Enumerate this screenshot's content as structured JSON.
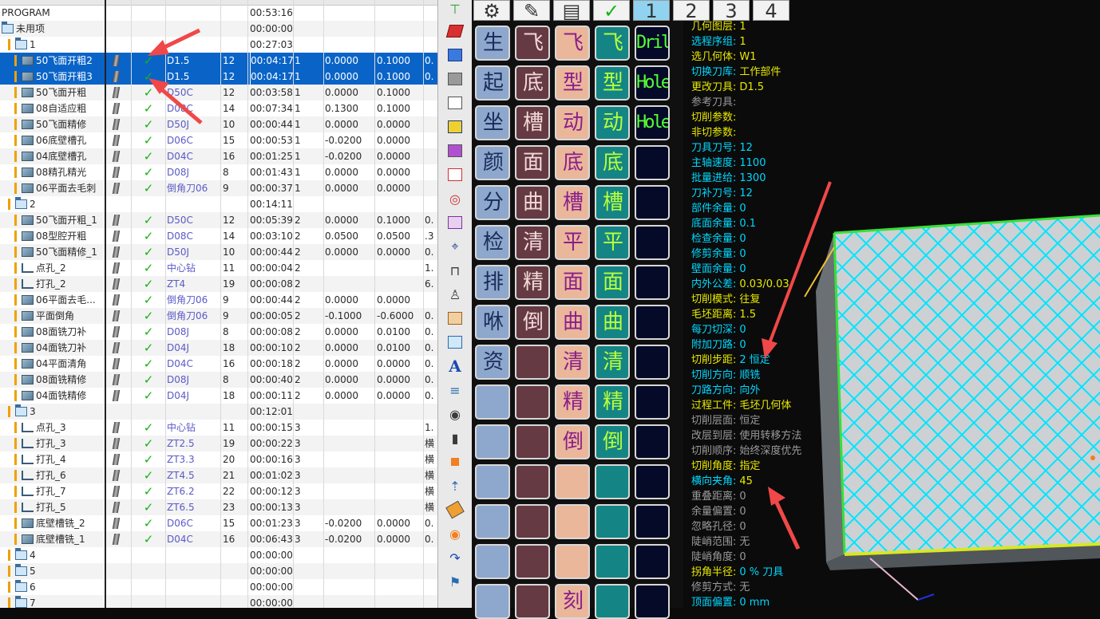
{
  "navigator": {
    "rows": [
      {
        "indent": 0,
        "icon": "none",
        "name": "PROGRAM",
        "gou": false,
        "chk": false,
        "tool": "",
        "num": "",
        "time": "00:53:16",
        "lay": "",
        "a": "",
        "b": "",
        "e": "",
        "sel": false
      },
      {
        "indent": 0,
        "icon": "folder",
        "name": "未用项",
        "gou": false,
        "chk": false,
        "tool": "",
        "num": "",
        "time": "00:00:00",
        "lay": "",
        "a": "",
        "b": "",
        "e": "",
        "sel": false
      },
      {
        "indent": 1,
        "icon": "folder",
        "name": "1",
        "gou": false,
        "chk": false,
        "tool": "",
        "num": "",
        "time": "00:27:03",
        "lay": "",
        "a": "",
        "b": "",
        "e": "",
        "sel": false
      },
      {
        "indent": 2,
        "icon": "op",
        "name": "50飞面开粗2",
        "gou": true,
        "chk": true,
        "tool": "D1.5",
        "num": "12",
        "time": "00:04:17",
        "lay": "1",
        "a": "0.0000",
        "b": "0.1000",
        "e": "0.",
        "sel": true
      },
      {
        "indent": 2,
        "icon": "op",
        "name": "50飞面开粗3",
        "gou": true,
        "chk": true,
        "tool": "D1.5",
        "num": "12",
        "time": "00:04:17",
        "lay": "1",
        "a": "0.0000",
        "b": "0.1000",
        "e": "0.",
        "sel": true
      },
      {
        "indent": 2,
        "icon": "op",
        "name": "50飞面开粗",
        "gou": true,
        "chk": true,
        "tool": "D50C",
        "num": "12",
        "time": "00:03:58",
        "lay": "1",
        "a": "0.0000",
        "b": "0.1000",
        "e": "",
        "sel": false
      },
      {
        "indent": 2,
        "icon": "op",
        "name": "08自适应粗",
        "gou": true,
        "chk": true,
        "tool": "D08C",
        "num": "14",
        "time": "00:07:34",
        "lay": "1",
        "a": "0.1300",
        "b": "0.1000",
        "e": "",
        "sel": false
      },
      {
        "indent": 2,
        "icon": "op",
        "name": "50飞面精修",
        "gou": true,
        "chk": true,
        "tool": "D50J",
        "num": "10",
        "time": "00:00:44",
        "lay": "1",
        "a": "0.0000",
        "b": "0.0000",
        "e": "",
        "sel": false
      },
      {
        "indent": 2,
        "icon": "op",
        "name": "06底壁槽孔",
        "gou": true,
        "chk": true,
        "tool": "D06C",
        "num": "15",
        "time": "00:00:53",
        "lay": "1",
        "a": "-0.0200",
        "b": "0.0000",
        "e": "",
        "sel": false
      },
      {
        "indent": 2,
        "icon": "op",
        "name": "04底壁槽孔",
        "gou": true,
        "chk": true,
        "tool": "D04C",
        "num": "16",
        "time": "00:01:25",
        "lay": "1",
        "a": "-0.0200",
        "b": "0.0000",
        "e": "",
        "sel": false
      },
      {
        "indent": 2,
        "icon": "op",
        "name": "08精孔精光",
        "gou": true,
        "chk": true,
        "tool": "D08J",
        "num": "8",
        "time": "00:01:43",
        "lay": "1",
        "a": "0.0000",
        "b": "0.0000",
        "e": "",
        "sel": false
      },
      {
        "indent": 2,
        "icon": "op",
        "name": "06平面去毛刺",
        "gou": true,
        "chk": true,
        "tool": "倒角刀06",
        "num": "9",
        "time": "00:00:37",
        "lay": "1",
        "a": "0.0000",
        "b": "0.0000",
        "e": "",
        "sel": false
      },
      {
        "indent": 1,
        "icon": "folder",
        "name": "2",
        "gou": false,
        "chk": false,
        "tool": "",
        "num": "",
        "time": "00:14:11",
        "lay": "",
        "a": "",
        "b": "",
        "e": "",
        "sel": false
      },
      {
        "indent": 2,
        "icon": "op",
        "name": "50飞面开粗_1",
        "gou": true,
        "chk": true,
        "tool": "D50C",
        "num": "12",
        "time": "00:05:39",
        "lay": "2",
        "a": "0.0000",
        "b": "0.1000",
        "e": "0.",
        "sel": false
      },
      {
        "indent": 2,
        "icon": "op",
        "name": "08型腔开粗",
        "gou": true,
        "chk": true,
        "tool": "D08C",
        "num": "14",
        "time": "00:03:10",
        "lay": "2",
        "a": "0.0500",
        "b": "0.0500",
        "e": ".3",
        "sel": false
      },
      {
        "indent": 2,
        "icon": "op",
        "name": "50飞面精修_1",
        "gou": true,
        "chk": true,
        "tool": "D50J",
        "num": "10",
        "time": "00:00:44",
        "lay": "2",
        "a": "0.0000",
        "b": "0.0000",
        "e": "0.",
        "sel": false
      },
      {
        "indent": 2,
        "icon": "drill",
        "name": "点孔_2",
        "gou": true,
        "chk": true,
        "tool": "中心钻",
        "num": "11",
        "time": "00:00:04",
        "lay": "2",
        "a": "",
        "b": "",
        "e": "1.",
        "sel": false
      },
      {
        "indent": 2,
        "icon": "drill",
        "name": "打孔_2",
        "gou": true,
        "chk": true,
        "tool": "ZT4",
        "num": "19",
        "time": "00:00:08",
        "lay": "2",
        "a": "",
        "b": "",
        "e": "6.",
        "sel": false
      },
      {
        "indent": 2,
        "icon": "op",
        "name": "06平面去毛...",
        "gou": true,
        "chk": true,
        "tool": "倒角刀06",
        "num": "9",
        "time": "00:00:44",
        "lay": "2",
        "a": "0.0000",
        "b": "0.0000",
        "e": "",
        "sel": false
      },
      {
        "indent": 2,
        "icon": "op",
        "name": "平面倒角",
        "gou": true,
        "chk": true,
        "tool": "倒角刀06",
        "num": "9",
        "time": "00:00:05",
        "lay": "2",
        "a": "-0.1000",
        "b": "-0.6000",
        "e": "0.",
        "sel": false
      },
      {
        "indent": 2,
        "icon": "op",
        "name": "08面铣刀补",
        "gou": true,
        "chk": true,
        "tool": "D08J",
        "num": "8",
        "time": "00:00:08",
        "lay": "2",
        "a": "0.0000",
        "b": "0.0100",
        "e": "0.",
        "sel": false
      },
      {
        "indent": 2,
        "icon": "op",
        "name": "04面铣刀补",
        "gou": true,
        "chk": true,
        "tool": "D04J",
        "num": "18",
        "time": "00:00:10",
        "lay": "2",
        "a": "0.0000",
        "b": "0.0100",
        "e": "0.",
        "sel": false
      },
      {
        "indent": 2,
        "icon": "op",
        "name": "04平面清角",
        "gou": true,
        "chk": true,
        "tool": "D04C",
        "num": "16",
        "time": "00:00:18",
        "lay": "2",
        "a": "0.0000",
        "b": "0.0000",
        "e": "0.",
        "sel": false
      },
      {
        "indent": 2,
        "icon": "op",
        "name": "08面铣精修",
        "gou": true,
        "chk": true,
        "tool": "D08J",
        "num": "8",
        "time": "00:00:40",
        "lay": "2",
        "a": "0.0000",
        "b": "0.0000",
        "e": "0.",
        "sel": false
      },
      {
        "indent": 2,
        "icon": "op",
        "name": "04面铣精修",
        "gou": true,
        "chk": true,
        "tool": "D04J",
        "num": "18",
        "time": "00:00:11",
        "lay": "2",
        "a": "0.0000",
        "b": "0.0000",
        "e": "0.",
        "sel": false
      },
      {
        "indent": 1,
        "icon": "folder",
        "name": "3",
        "gou": false,
        "chk": false,
        "tool": "",
        "num": "",
        "time": "00:12:01",
        "lay": "",
        "a": "",
        "b": "",
        "e": "",
        "sel": false
      },
      {
        "indent": 2,
        "icon": "drill",
        "name": "点孔_3",
        "gou": true,
        "chk": true,
        "tool": "中心钻",
        "num": "11",
        "time": "00:00:15",
        "lay": "3",
        "a": "",
        "b": "",
        "e": "1.",
        "sel": false
      },
      {
        "indent": 2,
        "icon": "drill",
        "name": "打孔_3",
        "gou": true,
        "chk": true,
        "tool": "ZT2.5",
        "num": "19",
        "time": "00:00:22",
        "lay": "3",
        "a": "",
        "b": "",
        "e": "横",
        "sel": false
      },
      {
        "indent": 2,
        "icon": "drill",
        "name": "打孔_4",
        "gou": true,
        "chk": true,
        "tool": "ZT3.3",
        "num": "20",
        "time": "00:00:16",
        "lay": "3",
        "a": "",
        "b": "",
        "e": "横",
        "sel": false
      },
      {
        "indent": 2,
        "icon": "drill",
        "name": "打孔_6",
        "gou": true,
        "chk": true,
        "tool": "ZT4.5",
        "num": "21",
        "time": "00:01:02",
        "lay": "3",
        "a": "",
        "b": "",
        "e": "横",
        "sel": false
      },
      {
        "indent": 2,
        "icon": "drill",
        "name": "打孔_7",
        "gou": true,
        "chk": true,
        "tool": "ZT6.2",
        "num": "22",
        "time": "00:00:12",
        "lay": "3",
        "a": "",
        "b": "",
        "e": "横",
        "sel": false
      },
      {
        "indent": 2,
        "icon": "drill",
        "name": "打孔_5",
        "gou": true,
        "chk": true,
        "tool": "ZT6.5",
        "num": "23",
        "time": "00:00:13",
        "lay": "3",
        "a": "",
        "b": "",
        "e": "横",
        "sel": false
      },
      {
        "indent": 2,
        "icon": "op",
        "name": "底壁槽铣_2",
        "gou": true,
        "chk": true,
        "tool": "D06C",
        "num": "15",
        "time": "00:01:23",
        "lay": "3",
        "a": "-0.0200",
        "b": "0.0000",
        "e": "0.",
        "sel": false
      },
      {
        "indent": 2,
        "icon": "op",
        "name": "底壁槽铣_1",
        "gou": true,
        "chk": true,
        "tool": "D04C",
        "num": "16",
        "time": "00:06:43",
        "lay": "3",
        "a": "-0.0200",
        "b": "0.0000",
        "e": "0.",
        "sel": false
      },
      {
        "indent": 1,
        "icon": "folder",
        "name": "4",
        "gou": false,
        "chk": false,
        "tool": "",
        "num": "",
        "time": "00:00:00",
        "lay": "",
        "a": "",
        "b": "",
        "e": "",
        "sel": false
      },
      {
        "indent": 1,
        "icon": "folder",
        "name": "5",
        "gou": false,
        "chk": false,
        "tool": "",
        "num": "",
        "time": "00:00:00",
        "lay": "",
        "a": "",
        "b": "",
        "e": "",
        "sel": false
      },
      {
        "indent": 1,
        "icon": "folder",
        "name": "6",
        "gou": false,
        "chk": false,
        "tool": "",
        "num": "",
        "time": "00:00:00",
        "lay": "",
        "a": "",
        "b": "",
        "e": "",
        "sel": false
      },
      {
        "indent": 1,
        "icon": "folder",
        "name": "7",
        "gou": false,
        "chk": false,
        "tool": "",
        "num": "",
        "time": "00:00:00",
        "lay": "",
        "a": "",
        "b": "",
        "e": "",
        "sel": false
      }
    ]
  },
  "tabs": [
    {
      "label": "⚙",
      "active": false
    },
    {
      "label": "✎",
      "active": false
    },
    {
      "label": "▤",
      "active": false
    },
    {
      "label": "✓",
      "active": false
    },
    {
      "label": "1",
      "active": true
    },
    {
      "label": "2",
      "active": false
    },
    {
      "label": "3",
      "active": false
    },
    {
      "label": "4",
      "active": false
    }
  ],
  "grid": [
    [
      {
        "t": "生成",
        "c": "blue"
      },
      {
        "t": "飞面",
        "c": "maroon"
      },
      {
        "t": "飞面",
        "c": "peach"
      },
      {
        "t": "飞面",
        "c": "teal"
      },
      {
        "t": "Drill",
        "c": "navy"
      }
    ],
    [
      {
        "t": "起手",
        "c": "blue"
      },
      {
        "t": "底壁",
        "c": "maroon"
      },
      {
        "t": "型腔",
        "c": "peach"
      },
      {
        "t": "型腔",
        "c": "teal"
      },
      {
        "t": "Hole",
        "c": "navy"
      }
    ],
    [
      {
        "t": "坐标",
        "c": "blue"
      },
      {
        "t": "槽孔",
        "c": "maroon"
      },
      {
        "t": "动态",
        "c": "peach"
      },
      {
        "t": "动态",
        "c": "teal"
      },
      {
        "t": "Hole",
        "c": "navy"
      }
    ],
    [
      {
        "t": "颜色",
        "c": "blue"
      },
      {
        "t": "面铣",
        "c": "maroon"
      },
      {
        "t": "底壁",
        "c": "peach"
      },
      {
        "t": "底壁",
        "c": "teal"
      },
      {
        "t": "",
        "c": "navy"
      }
    ],
    [
      {
        "t": "分析",
        "c": "blue"
      },
      {
        "t": "曲面",
        "c": "maroon"
      },
      {
        "t": "槽孔",
        "c": "peach"
      },
      {
        "t": "槽孔",
        "c": "teal"
      },
      {
        "t": "",
        "c": "navy"
      }
    ],
    [
      {
        "t": "检查",
        "c": "blue"
      },
      {
        "t": "清角",
        "c": "maroon"
      },
      {
        "t": "平面",
        "c": "peach"
      },
      {
        "t": "平面",
        "c": "teal"
      },
      {
        "t": "",
        "c": "navy"
      }
    ],
    [
      {
        "t": "排刀",
        "c": "blue"
      },
      {
        "t": "精孔",
        "c": "maroon"
      },
      {
        "t": "面铣",
        "c": "peach"
      },
      {
        "t": "面铣",
        "c": "teal"
      },
      {
        "t": "",
        "c": "navy"
      }
    ],
    [
      {
        "t": "咻咻",
        "c": "blue"
      },
      {
        "t": "倒角",
        "c": "maroon"
      },
      {
        "t": "曲面",
        "c": "peach"
      },
      {
        "t": "曲面",
        "c": "teal"
      },
      {
        "t": "",
        "c": "navy"
      }
    ],
    [
      {
        "t": "资料",
        "c": "blue"
      },
      {
        "t": "",
        "c": "maroon"
      },
      {
        "t": "清角",
        "c": "peach"
      },
      {
        "t": "清角",
        "c": "teal"
      },
      {
        "t": "",
        "c": "navy"
      }
    ],
    [
      {
        "t": "",
        "c": "blue"
      },
      {
        "t": "",
        "c": "maroon"
      },
      {
        "t": "精孔",
        "c": "peach"
      },
      {
        "t": "精孔",
        "c": "teal"
      },
      {
        "t": "",
        "c": "navy"
      }
    ],
    [
      {
        "t": "",
        "c": "blue"
      },
      {
        "t": "",
        "c": "maroon"
      },
      {
        "t": "倒角",
        "c": "peach"
      },
      {
        "t": "倒角",
        "c": "teal"
      },
      {
        "t": "",
        "c": "navy"
      }
    ],
    [
      {
        "t": "",
        "c": "blue"
      },
      {
        "t": "",
        "c": "maroon"
      },
      {
        "t": "",
        "c": "peach"
      },
      {
        "t": "",
        "c": "teal"
      },
      {
        "t": "",
        "c": "navy"
      }
    ],
    [
      {
        "t": "",
        "c": "blue"
      },
      {
        "t": "",
        "c": "maroon"
      },
      {
        "t": "",
        "c": "peach"
      },
      {
        "t": "",
        "c": "teal"
      },
      {
        "t": "",
        "c": "navy"
      }
    ],
    [
      {
        "t": "",
        "c": "blue"
      },
      {
        "t": "",
        "c": "maroon"
      },
      {
        "t": "",
        "c": "peach"
      },
      {
        "t": "",
        "c": "teal"
      },
      {
        "t": "",
        "c": "navy"
      }
    ],
    [
      {
        "t": "",
        "c": "blue"
      },
      {
        "t": "",
        "c": "maroon"
      },
      {
        "t": "刻字",
        "c": "peach"
      },
      {
        "t": "",
        "c": "teal"
      },
      {
        "t": "",
        "c": "navy"
      }
    ]
  ],
  "info": [
    {
      "l": "几何图层:",
      "v": "1",
      "lc": "y",
      "vc": "y"
    },
    {
      "l": "选程序组:",
      "v": "1",
      "lc": "c",
      "vc": "y"
    },
    {
      "l": "选几何体:",
      "v": "W1",
      "lc": "y",
      "vc": "y"
    },
    {
      "l": "切换刀库:",
      "v": "工作部件",
      "lc": "c",
      "vc": "y"
    },
    {
      "l": "更改刀具:",
      "v": "D1.5",
      "lc": "y",
      "vc": "y"
    },
    {
      "l": "参考刀具:",
      "v": "",
      "lc": "g",
      "vc": "g"
    },
    {
      "l": "切削参数:",
      "v": "",
      "lc": "y",
      "vc": "y"
    },
    {
      "l": "非切参数:",
      "v": "",
      "lc": "y",
      "vc": "y"
    },
    {
      "l": "刀具刀号:",
      "v": "12",
      "lc": "c",
      "vc": "c"
    },
    {
      "l": "主轴速度:",
      "v": "1100",
      "lc": "c",
      "vc": "c"
    },
    {
      "l": "批量进给:",
      "v": "1300",
      "lc": "c",
      "vc": "c"
    },
    {
      "l": "刀补刀号:",
      "v": "12",
      "lc": "c",
      "vc": "c"
    },
    {
      "l": "部件余量:",
      "v": "0",
      "lc": "c",
      "vc": "c"
    },
    {
      "l": "底面余量:",
      "v": "0.1",
      "lc": "c",
      "vc": "c"
    },
    {
      "l": "检查余量:",
      "v": "0",
      "lc": "c",
      "vc": "c"
    },
    {
      "l": "修剪余量:",
      "v": "0",
      "lc": "c",
      "vc": "c"
    },
    {
      "l": "壁面余量:",
      "v": "0",
      "lc": "c",
      "vc": "c"
    },
    {
      "l": "内外公差:",
      "v": "0.03/0.03",
      "lc": "c",
      "vc": "y"
    },
    {
      "l": "切削模式:",
      "v": "往复",
      "lc": "y",
      "vc": "y"
    },
    {
      "l": "毛坯距离:",
      "v": "1.5",
      "lc": "y",
      "vc": "y"
    },
    {
      "l": "每刀切深:",
      "v": "0",
      "lc": "c",
      "vc": "c"
    },
    {
      "l": "附加刀路:",
      "v": "0",
      "lc": "c",
      "vc": "c"
    },
    {
      "l": "切削步距:",
      "v": "2    恒定",
      "lc": "y",
      "vc": "c"
    },
    {
      "l": "切削方向:",
      "v": "顺铣",
      "lc": "c",
      "vc": "c"
    },
    {
      "l": "刀路方向:",
      "v": "向外",
      "lc": "c",
      "vc": "c"
    },
    {
      "l": "过程工件:",
      "v": "毛坯几何体",
      "lc": "y",
      "vc": "y"
    },
    {
      "l": "切削层面:",
      "v": "恒定",
      "lc": "g",
      "vc": "g"
    },
    {
      "l": "改层到层:",
      "v": "使用转移方法",
      "lc": "g",
      "vc": "g"
    },
    {
      "l": "切削顺序:",
      "v": "始终深度优先",
      "lc": "g",
      "vc": "g"
    },
    {
      "l": "切削角度:",
      "v": "指定",
      "lc": "y",
      "vc": "y"
    },
    {
      "l": "横向夹角:",
      "v": "45",
      "lc": "c",
      "vc": "y"
    },
    {
      "l": "重叠距离:",
      "v": "0",
      "lc": "g",
      "vc": "g"
    },
    {
      "l": "余量偏置:",
      "v": "0",
      "lc": "g",
      "vc": "g"
    },
    {
      "l": "忽略孔径:",
      "v": "0",
      "lc": "g",
      "vc": "g"
    },
    {
      "l": "陡峭范围:",
      "v": "无",
      "lc": "g",
      "vc": "g"
    },
    {
      "l": "陡峭角度:",
      "v": "0",
      "lc": "g",
      "vc": "g"
    },
    {
      "l": "拐角半径:",
      "v": "0    % 刀具",
      "lc": "y",
      "vc": "c"
    },
    {
      "l": "修剪方式:",
      "v": "无",
      "lc": "g",
      "vc": "g"
    },
    {
      "l": "顶面偏置:",
      "v": "0    mm",
      "lc": "c",
      "vc": "c"
    }
  ],
  "colors": {
    "selection": "#0a64c8",
    "toolpath": "#00e5ff",
    "annotation": "#f04848",
    "info_yellow": "#e8e800",
    "info_cyan": "#00d8ff"
  }
}
